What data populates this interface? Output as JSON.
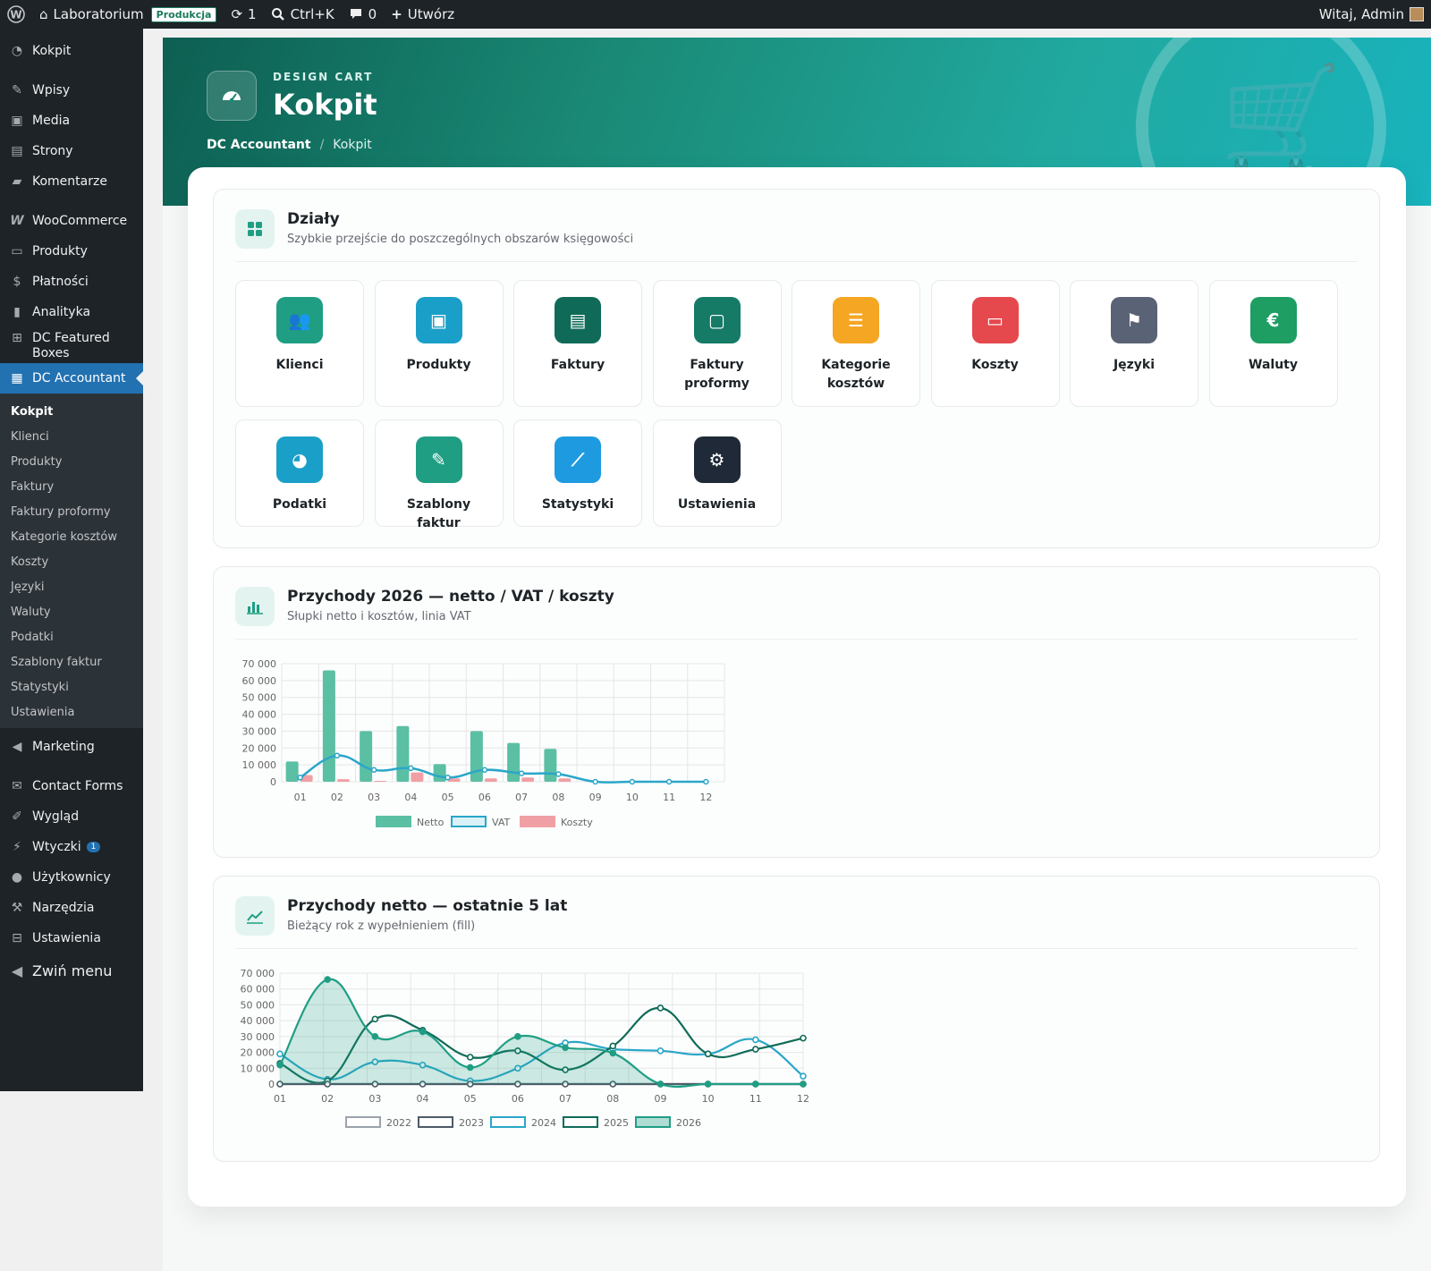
{
  "adminbar": {
    "site": "Laboratorium",
    "env": "Produkcja",
    "updates": "1",
    "search": "Ctrl+K",
    "comments": "0",
    "new": "Utwórz",
    "greeting": "Witaj, Admin"
  },
  "sidebar": {
    "items": [
      {
        "label": "Kokpit",
        "icon": "dashboard-icon"
      },
      {
        "label": "Wpisy",
        "icon": "pin-icon"
      },
      {
        "label": "Media",
        "icon": "media-icon"
      },
      {
        "label": "Strony",
        "icon": "page-icon"
      },
      {
        "label": "Komentarze",
        "icon": "comment-icon"
      },
      {
        "label": "WooCommerce",
        "icon": "woo-icon"
      },
      {
        "label": "Produkty",
        "icon": "archive-icon"
      },
      {
        "label": "Płatności",
        "icon": "payment-icon"
      },
      {
        "label": "Analityka",
        "icon": "bar-chart-icon"
      },
      {
        "label": "DC Featured Boxes",
        "icon": "grid-icon"
      },
      {
        "label": "DC Accountant",
        "icon": "calculator-icon"
      },
      {
        "label": "Marketing",
        "icon": "megaphone-icon"
      },
      {
        "label": "Contact Forms",
        "icon": "mail-icon"
      },
      {
        "label": "Wygląd",
        "icon": "brush-icon"
      },
      {
        "label": "Wtyczki",
        "icon": "plugin-icon",
        "badge": "1"
      },
      {
        "label": "Użytkownicy",
        "icon": "user-icon"
      },
      {
        "label": "Narzędzia",
        "icon": "wrench-icon"
      },
      {
        "label": "Ustawienia",
        "icon": "settings-icon"
      },
      {
        "label": "Zwiń menu",
        "icon": "collapse-icon"
      }
    ],
    "submenu": [
      "Kokpit",
      "Klienci",
      "Produkty",
      "Faktury",
      "Faktury proformy",
      "Kategorie kosztów",
      "Koszty",
      "Języki",
      "Waluty",
      "Podatki",
      "Szablony faktur",
      "Statystyki",
      "Ustawienia"
    ]
  },
  "hero": {
    "eyebrow": "DESIGN CART",
    "title": "Kokpit",
    "crumb_root": "DC Accountant",
    "crumb_current": "Kokpit",
    "watermark": "Design Cart"
  },
  "sections": {
    "title": "Działy",
    "subtitle": "Szybkie przejście do poszczególnych obszarów księgowości",
    "tiles": [
      {
        "label": "Klienci",
        "icon": "users-icon",
        "color": "#1f9e84"
      },
      {
        "label": "Produkty",
        "icon": "box-icon",
        "color": "#1aa0c8"
      },
      {
        "label": "Faktury",
        "icon": "document-icon",
        "color": "#0f6b58"
      },
      {
        "label": "Faktury proformy",
        "icon": "document-outline-icon",
        "color": "#157a66"
      },
      {
        "label": "Kategorie kosztów",
        "icon": "list-icon",
        "color": "#f5a623"
      },
      {
        "label": "Koszty",
        "icon": "money-icon",
        "color": "#e5484d"
      },
      {
        "label": "Języki",
        "icon": "flag-icon",
        "color": "#5a6375"
      },
      {
        "label": "Waluty",
        "icon": "euro-icon",
        "color": "#1e9e63"
      },
      {
        "label": "Podatki",
        "icon": "pie-icon",
        "color": "#1aa0c8"
      },
      {
        "label": "Szablony faktur",
        "icon": "brush-icon",
        "color": "#1f9e84"
      },
      {
        "label": "Statystyki",
        "icon": "line-chart-icon",
        "color": "#1e9be0"
      },
      {
        "label": "Ustawienia",
        "icon": "gear-icon",
        "color": "#1f2937"
      }
    ]
  },
  "colors": {
    "netto": "#5bbfa4",
    "vat": "#2aa6c9",
    "koszty": "#f0a0a4"
  },
  "chart_data": [
    {
      "type": "bar",
      "title": "Przychody 2026 — netto / VAT / koszty",
      "subtitle": "Słupki netto i kosztów, linia VAT",
      "categories": [
        "01",
        "02",
        "03",
        "04",
        "05",
        "06",
        "07",
        "08",
        "09",
        "10",
        "11",
        "12"
      ],
      "series": [
        {
          "name": "Netto",
          "values": [
            12000,
            66000,
            30000,
            33000,
            10500,
            30000,
            23000,
            19500,
            0,
            0,
            0,
            0
          ]
        },
        {
          "name": "VAT",
          "type": "line",
          "values": [
            2500,
            15500,
            7000,
            8000,
            2500,
            7000,
            5000,
            4500,
            0,
            0,
            0,
            0
          ]
        },
        {
          "name": "Koszty",
          "values": [
            4000,
            1500,
            500,
            5500,
            2000,
            2000,
            2500,
            2000,
            0,
            0,
            0,
            0
          ]
        }
      ],
      "yticks": [
        "0",
        "10 000",
        "20 000",
        "30 000",
        "40 000",
        "50 000",
        "60 000",
        "70 000"
      ],
      "ylim": [
        0,
        70000
      ],
      "legend": "bottom"
    },
    {
      "type": "line",
      "title": "Przychody netto — ostatnie 5 lat",
      "subtitle": "Bieżący rok z wypełnieniem (fill)",
      "categories": [
        "01",
        "02",
        "03",
        "04",
        "05",
        "06",
        "07",
        "08",
        "09",
        "10",
        "11",
        "12"
      ],
      "series": [
        {
          "name": "2022",
          "color": "#9aa3ab",
          "values": [
            0,
            0,
            0,
            0,
            0,
            0,
            0,
            0,
            0,
            0,
            0,
            0
          ]
        },
        {
          "name": "2023",
          "color": "#4d5a66",
          "values": [
            0,
            0,
            0,
            0,
            0,
            0,
            0,
            0,
            0,
            0,
            0,
            0
          ]
        },
        {
          "name": "2024",
          "color": "#2aa6c9",
          "values": [
            19000,
            3000,
            14000,
            12000,
            2000,
            10000,
            26000,
            22000,
            21000,
            19000,
            28000,
            5000
          ]
        },
        {
          "name": "2025",
          "color": "#0f6b58",
          "values": [
            13000,
            2000,
            41000,
            34000,
            17000,
            21000,
            9000,
            24000,
            48000,
            19000,
            22000,
            29000
          ]
        },
        {
          "name": "2026",
          "color": "#1f9e84",
          "fill": true,
          "values": [
            12000,
            66000,
            30000,
            33000,
            10500,
            30000,
            23000,
            19500,
            0,
            0,
            0,
            0
          ]
        }
      ],
      "yticks": [
        "0",
        "10 000",
        "20 000",
        "30 000",
        "40 000",
        "50 000",
        "60 000",
        "70 000"
      ],
      "ylim": [
        0,
        70000
      ],
      "legend": "bottom"
    }
  ]
}
